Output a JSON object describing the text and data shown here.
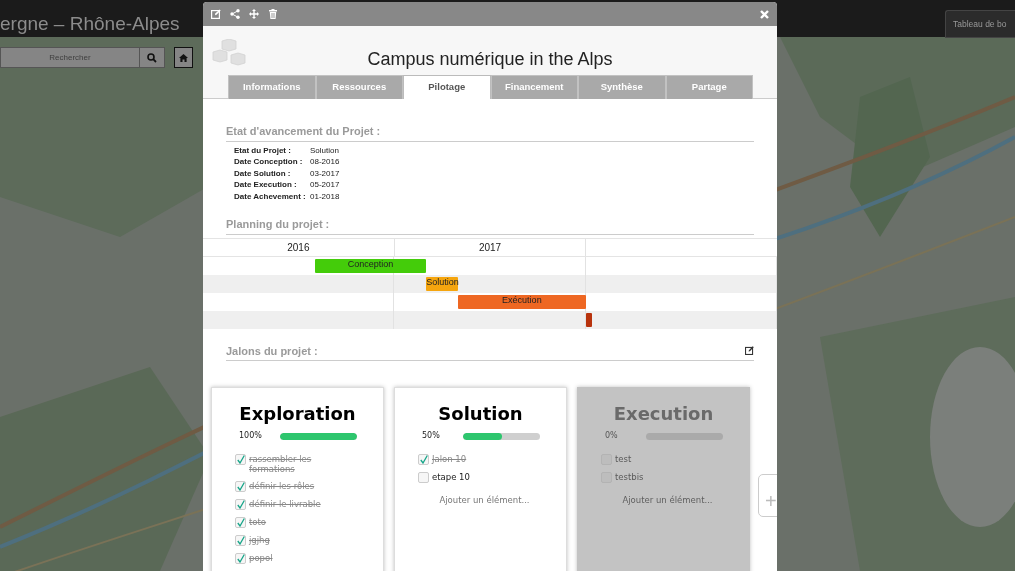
{
  "header": {
    "region": "ergne – Rhône-Alpes",
    "search": {
      "placeholder": "Rechercher"
    },
    "dashboard_button": "Tableau de bo"
  },
  "modal": {
    "title": "Campus numérique in the Alps",
    "tabs": [
      {
        "label": "Informations",
        "selected": false
      },
      {
        "label": "Ressources",
        "selected": false
      },
      {
        "label": "Pilotage",
        "selected": true
      },
      {
        "label": "Financement",
        "selected": false
      },
      {
        "label": "Synthèse",
        "selected": false
      },
      {
        "label": "Partage",
        "selected": false
      }
    ],
    "status": {
      "heading": "Etat d'avancement du Projet :",
      "rows": [
        {
          "label": "Etat du Projet :",
          "value": "Solution"
        },
        {
          "label": "Date Conception :",
          "value": "08-2016"
        },
        {
          "label": "Date Solution :",
          "value": "03-2017"
        },
        {
          "label": "Date Execution :",
          "value": "05-2017"
        },
        {
          "label": "Date Achevement :",
          "value": "01-2018"
        }
      ]
    },
    "planning": {
      "heading": "Planning du projet :",
      "years": [
        "2016",
        "2017"
      ],
      "tasks": [
        {
          "label": "Conception",
          "color": "#44cc0a"
        },
        {
          "label": "Solution",
          "color": "#f5a50e"
        },
        {
          "label": "Exécution",
          "color": "#ee6722"
        },
        {
          "color": "#b8330d"
        }
      ]
    },
    "milestones": {
      "heading": "Jalons du projet :",
      "add_column_button": "+",
      "columns": [
        {
          "title": "Exploration",
          "percent": "100%",
          "level": 1,
          "disabled": false,
          "items": [
            {
              "text": "rassembler les formations",
              "checked": true
            },
            {
              "text": "définir les rôles",
              "checked": true
            },
            {
              "text": "définir le livrable",
              "checked": true
            },
            {
              "text": "toto",
              "checked": true
            },
            {
              "text": "jgjhg",
              "checked": true
            },
            {
              "text": "popol",
              "checked": true
            }
          ]
        },
        {
          "title": "Solution",
          "percent": "50%",
          "level": 0.5,
          "disabled": false,
          "add_placeholder": "Ajouter un élément...",
          "items": [
            {
              "text": "Jalon 10",
              "checked": true
            },
            {
              "text": "etape 10",
              "checked": false
            }
          ]
        },
        {
          "title": "Execution",
          "percent": "0%",
          "level": 0,
          "disabled": true,
          "add_placeholder": "Ajouter un élément...",
          "items": [
            {
              "text": "test",
              "checked": false
            },
            {
              "text": "testbis",
              "checked": false
            }
          ]
        }
      ]
    }
  }
}
